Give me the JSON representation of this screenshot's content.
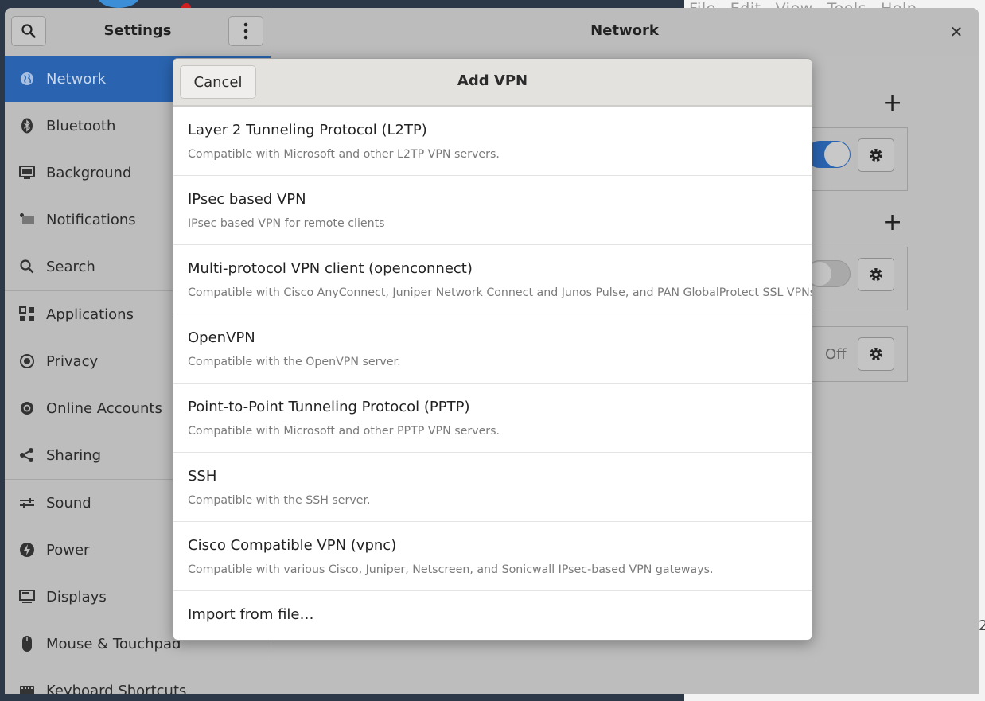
{
  "background": {
    "menubar": [
      "File",
      "Edit",
      "View",
      "Tools",
      "Help"
    ],
    "edge_number": "2"
  },
  "settings": {
    "title": "Settings",
    "panel_title": "Network",
    "sidebar": [
      {
        "label": "Network",
        "icon": "globe-icon",
        "active": true
      },
      {
        "label": "Bluetooth",
        "icon": "bluetooth-icon"
      },
      {
        "label": "Background",
        "icon": "monitor-image-icon"
      },
      {
        "label": "Notifications",
        "icon": "notification-icon"
      },
      {
        "label": "Search",
        "icon": "search-icon"
      },
      {
        "label": "Applications",
        "icon": "applications-grid-icon"
      },
      {
        "label": "Privacy",
        "icon": "privacy-icon"
      },
      {
        "label": "Online Accounts",
        "icon": "at-sign-icon"
      },
      {
        "label": "Sharing",
        "icon": "share-icon"
      },
      {
        "label": "Sound",
        "icon": "sound-sliders-icon"
      },
      {
        "label": "Power",
        "icon": "power-icon"
      },
      {
        "label": "Displays",
        "icon": "display-icon"
      },
      {
        "label": "Mouse & Touchpad",
        "icon": "mouse-icon"
      },
      {
        "label": "Keyboard Shortcuts",
        "icon": "keyboard-icon"
      }
    ],
    "main": {
      "off_label": "Off"
    }
  },
  "dialog": {
    "title": "Add VPN",
    "cancel_label": "Cancel",
    "options": [
      {
        "name": "Layer 2 Tunneling Protocol (L2TP)",
        "description": "Compatible with Microsoft and other L2TP VPN servers."
      },
      {
        "name": "IPsec based VPN",
        "description": "IPsec based VPN for remote clients"
      },
      {
        "name": "Multi-protocol VPN client (openconnect)",
        "description": "Compatible with Cisco AnyConnect, Juniper Network Connect and Junos Pulse, and PAN GlobalProtect SSL VPNs."
      },
      {
        "name": "OpenVPN",
        "description": "Compatible with the OpenVPN server."
      },
      {
        "name": "Point-to-Point Tunneling Protocol (PPTP)",
        "description": "Compatible with Microsoft and other PPTP VPN servers."
      },
      {
        "name": "SSH",
        "description": "Compatible with the SSH server."
      },
      {
        "name": "Cisco Compatible VPN (vpnc)",
        "description": "Compatible with various Cisco, Juniper, Netscreen, and Sonicwall IPsec-based VPN gateways."
      }
    ],
    "import_label": "Import from file…"
  },
  "colors": {
    "accent": "#2a64b0",
    "dim_background": "#bdbdbd",
    "dialog_header": "#e4e2de"
  }
}
